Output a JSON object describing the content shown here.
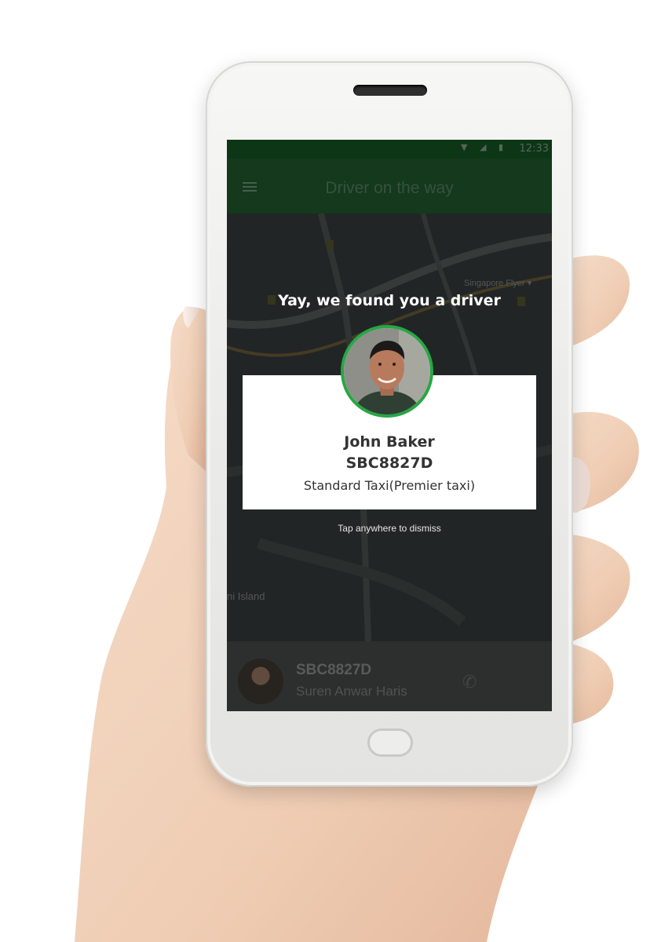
{
  "status_bar": {
    "time": "12:33",
    "icons": "▼ ◢ ▮"
  },
  "app_bar": {
    "title": "Driver on the way"
  },
  "map": {
    "labels": [
      "Singapore Flyer ▾",
      "ni Island"
    ]
  },
  "dialog": {
    "title": "Yay, we found you a driver",
    "driver_name": "John Baker",
    "plate": "SBC8827D",
    "service": "Standard Taxi(Premier taxi)",
    "dismiss_hint": "Tap anywhere to dismiss"
  },
  "bottom_panel": {
    "plate": "SBC8827D",
    "driver_name": "Suren Anwar Haris"
  },
  "colors": {
    "accent": "#27a744",
    "app_bar": "#163e1f",
    "overlay_card": "#ffffff"
  }
}
